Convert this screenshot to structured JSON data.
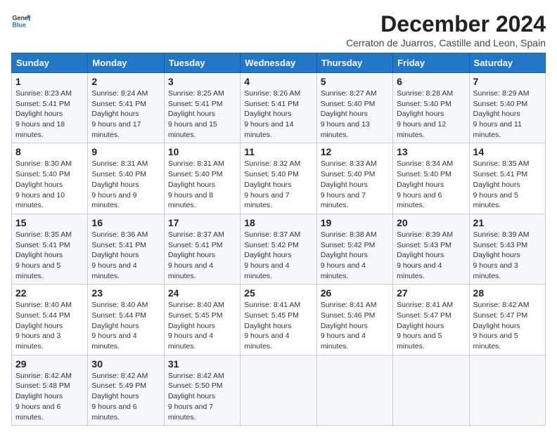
{
  "logo": {
    "line1": "General",
    "line2": "Blue"
  },
  "title": "December 2024",
  "subtitle": "Cerraton de Juarros, Castille and Leon, Spain",
  "days_header": [
    "Sunday",
    "Monday",
    "Tuesday",
    "Wednesday",
    "Thursday",
    "Friday",
    "Saturday"
  ],
  "weeks": [
    [
      {
        "day": "1",
        "sunrise": "8:23 AM",
        "sunset": "5:41 PM",
        "daylight": "9 hours and 18 minutes."
      },
      {
        "day": "2",
        "sunrise": "8:24 AM",
        "sunset": "5:41 PM",
        "daylight": "9 hours and 17 minutes."
      },
      {
        "day": "3",
        "sunrise": "8:25 AM",
        "sunset": "5:41 PM",
        "daylight": "9 hours and 15 minutes."
      },
      {
        "day": "4",
        "sunrise": "8:26 AM",
        "sunset": "5:41 PM",
        "daylight": "9 hours and 14 minutes."
      },
      {
        "day": "5",
        "sunrise": "8:27 AM",
        "sunset": "5:40 PM",
        "daylight": "9 hours and 13 minutes."
      },
      {
        "day": "6",
        "sunrise": "8:28 AM",
        "sunset": "5:40 PM",
        "daylight": "9 hours and 12 minutes."
      },
      {
        "day": "7",
        "sunrise": "8:29 AM",
        "sunset": "5:40 PM",
        "daylight": "9 hours and 11 minutes."
      }
    ],
    [
      {
        "day": "8",
        "sunrise": "8:30 AM",
        "sunset": "5:40 PM",
        "daylight": "9 hours and 10 minutes."
      },
      {
        "day": "9",
        "sunrise": "8:31 AM",
        "sunset": "5:40 PM",
        "daylight": "9 hours and 9 minutes."
      },
      {
        "day": "10",
        "sunrise": "8:31 AM",
        "sunset": "5:40 PM",
        "daylight": "9 hours and 8 minutes."
      },
      {
        "day": "11",
        "sunrise": "8:32 AM",
        "sunset": "5:40 PM",
        "daylight": "9 hours and 7 minutes."
      },
      {
        "day": "12",
        "sunrise": "8:33 AM",
        "sunset": "5:40 PM",
        "daylight": "9 hours and 7 minutes."
      },
      {
        "day": "13",
        "sunrise": "8:34 AM",
        "sunset": "5:40 PM",
        "daylight": "9 hours and 6 minutes."
      },
      {
        "day": "14",
        "sunrise": "8:35 AM",
        "sunset": "5:41 PM",
        "daylight": "9 hours and 5 minutes."
      }
    ],
    [
      {
        "day": "15",
        "sunrise": "8:35 AM",
        "sunset": "5:41 PM",
        "daylight": "9 hours and 5 minutes."
      },
      {
        "day": "16",
        "sunrise": "8:36 AM",
        "sunset": "5:41 PM",
        "daylight": "9 hours and 4 minutes."
      },
      {
        "day": "17",
        "sunrise": "8:37 AM",
        "sunset": "5:41 PM",
        "daylight": "9 hours and 4 minutes."
      },
      {
        "day": "18",
        "sunrise": "8:37 AM",
        "sunset": "5:42 PM",
        "daylight": "9 hours and 4 minutes."
      },
      {
        "day": "19",
        "sunrise": "8:38 AM",
        "sunset": "5:42 PM",
        "daylight": "9 hours and 4 minutes."
      },
      {
        "day": "20",
        "sunrise": "8:39 AM",
        "sunset": "5:43 PM",
        "daylight": "9 hours and 4 minutes."
      },
      {
        "day": "21",
        "sunrise": "8:39 AM",
        "sunset": "5:43 PM",
        "daylight": "9 hours and 3 minutes."
      }
    ],
    [
      {
        "day": "22",
        "sunrise": "8:40 AM",
        "sunset": "5:44 PM",
        "daylight": "9 hours and 3 minutes."
      },
      {
        "day": "23",
        "sunrise": "8:40 AM",
        "sunset": "5:44 PM",
        "daylight": "9 hours and 4 minutes."
      },
      {
        "day": "24",
        "sunrise": "8:40 AM",
        "sunset": "5:45 PM",
        "daylight": "9 hours and 4 minutes."
      },
      {
        "day": "25",
        "sunrise": "8:41 AM",
        "sunset": "5:45 PM",
        "daylight": "9 hours and 4 minutes."
      },
      {
        "day": "26",
        "sunrise": "8:41 AM",
        "sunset": "5:46 PM",
        "daylight": "9 hours and 4 minutes."
      },
      {
        "day": "27",
        "sunrise": "8:41 AM",
        "sunset": "5:47 PM",
        "daylight": "9 hours and 5 minutes."
      },
      {
        "day": "28",
        "sunrise": "8:42 AM",
        "sunset": "5:47 PM",
        "daylight": "9 hours and 5 minutes."
      }
    ],
    [
      {
        "day": "29",
        "sunrise": "8:42 AM",
        "sunset": "5:48 PM",
        "daylight": "9 hours and 6 minutes."
      },
      {
        "day": "30",
        "sunrise": "8:42 AM",
        "sunset": "5:49 PM",
        "daylight": "9 hours and 6 minutes."
      },
      {
        "day": "31",
        "sunrise": "8:42 AM",
        "sunset": "5:50 PM",
        "daylight": "9 hours and 7 minutes."
      },
      null,
      null,
      null,
      null
    ]
  ],
  "labels": {
    "sunrise": "Sunrise:",
    "sunset": "Sunset:",
    "daylight": "Daylight hours"
  }
}
